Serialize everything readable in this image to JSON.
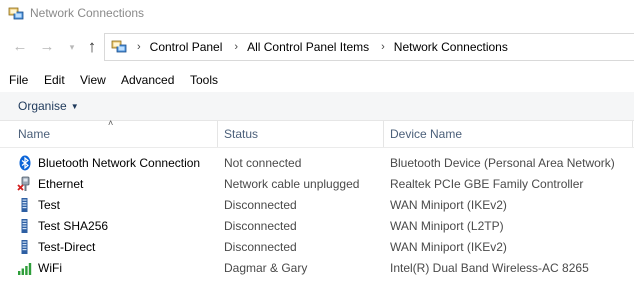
{
  "window": {
    "title": "Network Connections"
  },
  "nav": {
    "back_icon": "←",
    "forward_icon": "→",
    "recent_icon": "▾",
    "up_icon": "↑",
    "breadcrumb": [
      "Control Panel",
      "All Control Panel Items",
      "Network Connections"
    ],
    "separator": "›"
  },
  "menu": [
    "File",
    "Edit",
    "View",
    "Advanced",
    "Tools"
  ],
  "toolbar": {
    "organise_label": "Organise",
    "organise_caret": "▼"
  },
  "columns": {
    "name": "Name",
    "status": "Status",
    "device": "Device Name",
    "sort_indicator": "˄"
  },
  "connections": [
    {
      "name": "Bluetooth Network Connection",
      "status": "Not connected",
      "device": "Bluetooth Device (Personal Area Network)",
      "icon": "bluetooth-icon"
    },
    {
      "name": "Ethernet",
      "status": "Network cable unplugged",
      "device": "Realtek PCIe GBE Family Controller",
      "icon": "ethernet-disconnected-icon"
    },
    {
      "name": "Test",
      "status": "Disconnected",
      "device": "WAN Miniport (IKEv2)",
      "icon": "vpn-icon"
    },
    {
      "name": "Test SHA256",
      "status": "Disconnected",
      "device": "WAN Miniport (L2TP)",
      "icon": "vpn-icon"
    },
    {
      "name": "Test-Direct",
      "status": "Disconnected",
      "device": "WAN Miniport (IKEv2)",
      "icon": "vpn-icon"
    },
    {
      "name": "WiFi",
      "status": "Dagmar & Gary",
      "device": "Intel(R) Dual Band Wireless-AC 8265",
      "icon": "wifi-signal-icon"
    }
  ],
  "colors": {
    "header_text": "#4c607a",
    "organise_text": "#1e395b",
    "bluetooth": "#0a64d8",
    "wifi": "#2e9e3a",
    "error": "#d21f1f"
  }
}
